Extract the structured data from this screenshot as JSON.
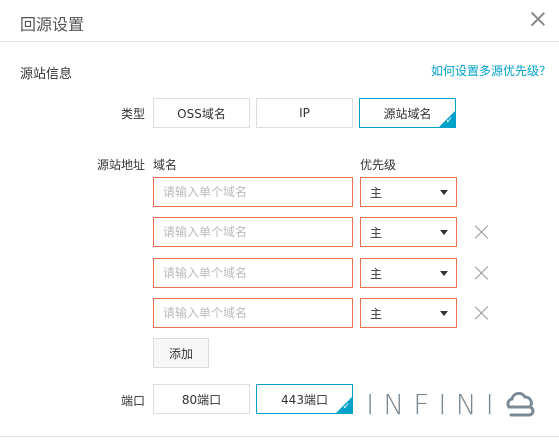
{
  "dialog": {
    "title": "回源设置"
  },
  "section": {
    "title": "源站信息",
    "help_link": "如何设置多源优先级？"
  },
  "type_row": {
    "label": "类型",
    "options": [
      "OSS域名",
      "IP",
      "源站域名"
    ],
    "selected": "源站域名"
  },
  "origin_row": {
    "label": "源站地址",
    "col_domain": "域名",
    "col_priority": "优先级",
    "rows": [
      {
        "placeholder": "请输入单个域名",
        "priority": "主"
      },
      {
        "placeholder": "请输入单个域名",
        "priority": "主"
      },
      {
        "placeholder": "请输入单个域名",
        "priority": "主"
      },
      {
        "placeholder": "请输入单个域名",
        "priority": "主"
      }
    ],
    "add_label": "添加"
  },
  "port_row": {
    "label": "端口",
    "options": [
      "80端口",
      "443端口"
    ],
    "selected": "443端口"
  },
  "watermark": {
    "text": "INFINI"
  },
  "colors": {
    "accent": "#00a2ca",
    "error_border": "#e8704c"
  }
}
